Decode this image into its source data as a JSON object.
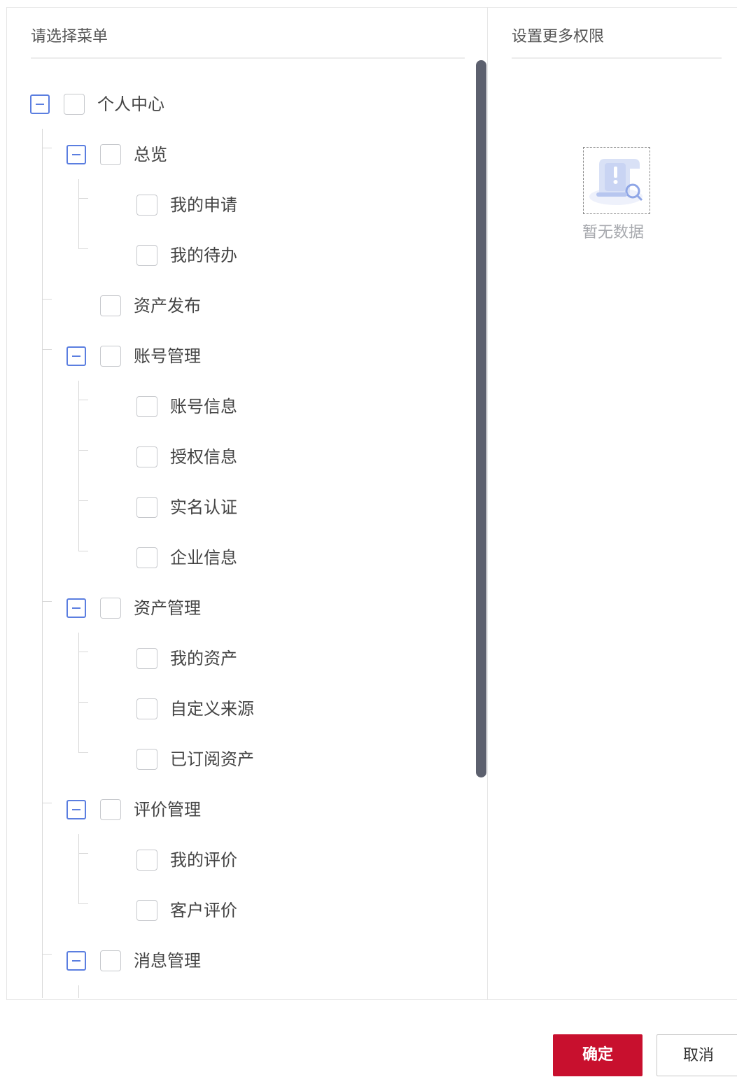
{
  "left_panel": {
    "title": "请选择菜单",
    "tree": [
      {
        "label": "个人中心"
      },
      {
        "label": "总览"
      },
      {
        "label": "我的申请"
      },
      {
        "label": "我的待办"
      },
      {
        "label": "资产发布"
      },
      {
        "label": "账号管理"
      },
      {
        "label": "账号信息"
      },
      {
        "label": "授权信息"
      },
      {
        "label": "实名认证"
      },
      {
        "label": "企业信息"
      },
      {
        "label": "资产管理"
      },
      {
        "label": "我的资产"
      },
      {
        "label": "自定义来源"
      },
      {
        "label": "已订阅资产"
      },
      {
        "label": "评价管理"
      },
      {
        "label": "我的评价"
      },
      {
        "label": "客户评价"
      },
      {
        "label": "消息管理"
      }
    ]
  },
  "right_panel": {
    "title": "设置更多权限",
    "empty_text": "暂无数据"
  },
  "footer": {
    "confirm_label": "确定",
    "cancel_label": "取消"
  },
  "colors": {
    "accent": "#5b7ee0",
    "primary_button": "#c8102e",
    "scrollbar": "#5c606e"
  }
}
